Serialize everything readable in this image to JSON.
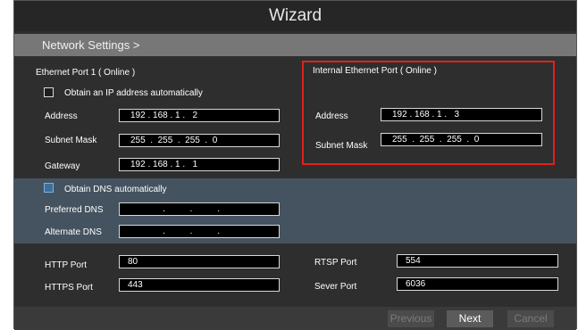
{
  "window": {
    "title": "Wizard"
  },
  "breadcrumb": "Network Settings  >",
  "ethernet1": {
    "heading": "Ethernet Port 1 ( Online )",
    "obtain_ip_label": "Obtain an IP address automatically",
    "address_label": "Address",
    "address_value": "192 . 168 . 1 .   2",
    "subnet_label": "Subnet Mask",
    "subnet_value": "255  .  255  .  255  .  0",
    "gateway_label": "Gateway",
    "gateway_value": "192 . 168 . 1 .   1"
  },
  "internal": {
    "heading": "Internal  Ethernet Port ( Online )",
    "address_label": "Address",
    "address_value": "192 . 168 . 1 .   3",
    "subnet_label": "Subnet Mask",
    "subnet_value": "255  .  255  .  255  .  0"
  },
  "dns": {
    "obtain_label": "Obtain DNS  automatically",
    "preferred_label": "Preferred  DNS",
    "preferred_value": "             .          .          .",
    "alternate_label": "Alternate  DNS",
    "alternate_value": "             .          .          ."
  },
  "ports": {
    "http_label": "HTTP Port",
    "http_value": "80",
    "https_label": "HTTPS Port",
    "https_value": "443",
    "rtsp_label": "RTSP Port",
    "rtsp_value": "554",
    "server_label": "Sever Port",
    "server_value": "6036"
  },
  "buttons": {
    "previous": "Previous",
    "next": "Next",
    "cancel": "Cancel"
  }
}
